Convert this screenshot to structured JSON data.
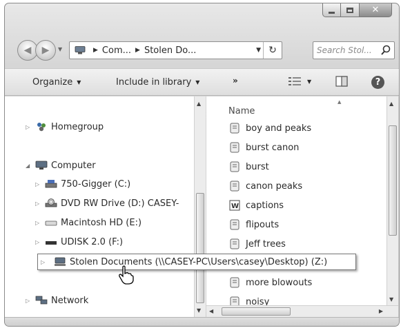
{
  "address_bar": {
    "crumbs": [
      "Com...",
      "Stolen Do..."
    ]
  },
  "search": {
    "placeholder": "Search Stol..."
  },
  "toolbar": {
    "organize": "Organize",
    "include_in_library": "Include in library",
    "more": "»"
  },
  "nav_pane": {
    "homegroup": "Homegroup",
    "computer": "Computer",
    "drives": [
      {
        "label": "750-Gigger (C:)"
      },
      {
        "label": "DVD RW Drive (D:) CASEY-"
      },
      {
        "label": "Macintosh HD (E:)"
      },
      {
        "label": "UDISK 2.0 (F:)"
      }
    ],
    "network": "Network",
    "hover_tooltip": "Stolen Documents (\\\\CASEY-PC\\Users\\casey\\Desktop) (Z:)"
  },
  "file_list": {
    "column_header": "Name",
    "items": [
      "boy and peaks",
      "burst canon",
      "burst",
      "canon peaks",
      "captions",
      "flipouts",
      "Jeff trees",
      "more blowouts",
      "noisy"
    ]
  }
}
